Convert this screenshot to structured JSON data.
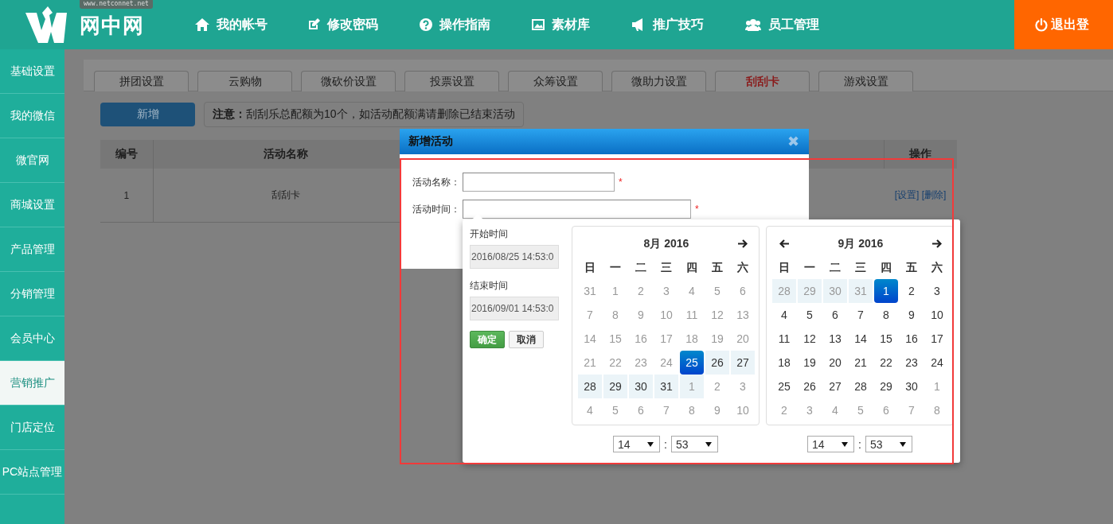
{
  "header": {
    "logo": {
      "domain": "www.netconnet.net",
      "name": "网中网"
    },
    "nav": [
      {
        "label": "我的帐号"
      },
      {
        "label": "修改密码"
      },
      {
        "label": "操作指南"
      },
      {
        "label": "素材库"
      },
      {
        "label": "推广技巧"
      },
      {
        "label": "员工管理"
      }
    ],
    "logout": "退出登"
  },
  "sidebar": {
    "items": [
      {
        "label": "基础设置",
        "selected": false
      },
      {
        "label": "我的微信",
        "selected": false
      },
      {
        "label": "微官网",
        "selected": false
      },
      {
        "label": "商城设置",
        "selected": false
      },
      {
        "label": "产品管理",
        "selected": false
      },
      {
        "label": "分销管理",
        "selected": false
      },
      {
        "label": "会员中心",
        "selected": false
      },
      {
        "label": "营销推广",
        "selected": true
      },
      {
        "label": "门店定位",
        "selected": false
      },
      {
        "label": "PC站点管理",
        "selected": false
      }
    ]
  },
  "tabs": [
    {
      "label": "拼团设置",
      "selected": false
    },
    {
      "label": "云购物",
      "selected": false
    },
    {
      "label": "微砍价设置",
      "selected": false
    },
    {
      "label": "投票设置",
      "selected": false
    },
    {
      "label": "众筹设置",
      "selected": false
    },
    {
      "label": "微助力设置",
      "selected": false
    },
    {
      "label": "刮刮卡",
      "selected": true
    },
    {
      "label": "游戏设置",
      "selected": false
    }
  ],
  "toolbar": {
    "add_button": "新增",
    "notice": "**注意：**刮刮乐总配额为10个，如活动配额满请删除已结束活动"
  },
  "table": {
    "columns": [
      "编号",
      "活动名称",
      "操作"
    ],
    "rows": [
      {
        "cells": [
          "1",
          "刮刮卡"
        ],
        "actions": [
          "[设置]",
          "[删除]"
        ]
      }
    ]
  },
  "dialog": {
    "title": "新增活动",
    "close": "✖",
    "fields": [
      {
        "label": "活动名称：",
        "mark": "*"
      },
      {
        "label": "活动时间：",
        "mark": "*"
      }
    ]
  },
  "picker": {
    "start_label": "开始时间",
    "start_value": "2016/08/25 14:53:0",
    "end_label": "结束时间",
    "end_value": "2016/09/01 14:53:0",
    "ok": "确定",
    "cancel": "取消",
    "months": [
      {
        "title": "8月 2016",
        "prev": false,
        "next": true,
        "weekdays": [
          "日",
          "一",
          "二",
          "三",
          "四",
          "五",
          "六"
        ],
        "hour": "14",
        "minute": "53",
        "separator": ":",
        "weeks": [
          [
            {
              "day": "31",
              "muted": true,
              "in_range": false,
              "selected": false
            },
            {
              "day": "1",
              "muted": true,
              "in_range": false,
              "selected": false
            },
            {
              "day": "2",
              "muted": true,
              "in_range": false,
              "selected": false
            },
            {
              "day": "3",
              "muted": true,
              "in_range": false,
              "selected": false
            },
            {
              "day": "4",
              "muted": true,
              "in_range": false,
              "selected": false
            },
            {
              "day": "5",
              "muted": true,
              "in_range": false,
              "selected": false
            },
            {
              "day": "6",
              "muted": true,
              "in_range": false,
              "selected": false
            }
          ],
          [
            {
              "day": "7",
              "muted": true,
              "in_range": false,
              "selected": false
            },
            {
              "day": "8",
              "muted": true,
              "in_range": false,
              "selected": false
            },
            {
              "day": "9",
              "muted": true,
              "in_range": false,
              "selected": false
            },
            {
              "day": "10",
              "muted": true,
              "in_range": false,
              "selected": false
            },
            {
              "day": "11",
              "muted": true,
              "in_range": false,
              "selected": false
            },
            {
              "day": "12",
              "muted": true,
              "in_range": false,
              "selected": false
            },
            {
              "day": "13",
              "muted": true,
              "in_range": false,
              "selected": false
            }
          ],
          [
            {
              "day": "14",
              "muted": true,
              "in_range": false,
              "selected": false
            },
            {
              "day": "15",
              "muted": true,
              "in_range": false,
              "selected": false
            },
            {
              "day": "16",
              "muted": true,
              "in_range": false,
              "selected": false
            },
            {
              "day": "17",
              "muted": true,
              "in_range": false,
              "selected": false
            },
            {
              "day": "18",
              "muted": true,
              "in_range": false,
              "selected": false
            },
            {
              "day": "19",
              "muted": true,
              "in_range": false,
              "selected": false
            },
            {
              "day": "20",
              "muted": true,
              "in_range": false,
              "selected": false
            }
          ],
          [
            {
              "day": "21",
              "muted": true,
              "in_range": false,
              "selected": false
            },
            {
              "day": "22",
              "muted": true,
              "in_range": false,
              "selected": false
            },
            {
              "day": "23",
              "muted": true,
              "in_range": false,
              "selected": false
            },
            {
              "day": "24",
              "muted": true,
              "in_range": false,
              "selected": false
            },
            {
              "day": "25",
              "muted": false,
              "in_range": false,
              "selected": true
            },
            {
              "day": "26",
              "muted": false,
              "in_range": true,
              "selected": false
            },
            {
              "day": "27",
              "muted": false,
              "in_range": true,
              "selected": false
            }
          ],
          [
            {
              "day": "28",
              "muted": false,
              "in_range": true,
              "selected": false
            },
            {
              "day": "29",
              "muted": false,
              "in_range": true,
              "selected": false
            },
            {
              "day": "30",
              "muted": false,
              "in_range": true,
              "selected": false
            },
            {
              "day": "31",
              "muted": false,
              "in_range": true,
              "selected": false
            },
            {
              "day": "1",
              "muted": true,
              "in_range": true,
              "selected": false
            },
            {
              "day": "2",
              "muted": true,
              "in_range": false,
              "selected": false
            },
            {
              "day": "3",
              "muted": true,
              "in_range": false,
              "selected": false
            }
          ],
          [
            {
              "day": "4",
              "muted": true,
              "in_range": false,
              "selected": false
            },
            {
              "day": "5",
              "muted": true,
              "in_range": false,
              "selected": false
            },
            {
              "day": "6",
              "muted": true,
              "in_range": false,
              "selected": false
            },
            {
              "day": "7",
              "muted": true,
              "in_range": false,
              "selected": false
            },
            {
              "day": "8",
              "muted": true,
              "in_range": false,
              "selected": false
            },
            {
              "day": "9",
              "muted": true,
              "in_range": false,
              "selected": false
            },
            {
              "day": "10",
              "muted": true,
              "in_range": false,
              "selected": false
            }
          ]
        ]
      },
      {
        "title": "9月 2016",
        "prev": true,
        "next": true,
        "weekdays": [
          "日",
          "一",
          "二",
          "三",
          "四",
          "五",
          "六"
        ],
        "hour": "14",
        "minute": "53",
        "separator": ":",
        "weeks": [
          [
            {
              "day": "28",
              "muted": true,
              "in_range": true,
              "selected": false
            },
            {
              "day": "29",
              "muted": true,
              "in_range": true,
              "selected": false
            },
            {
              "day": "30",
              "muted": true,
              "in_range": true,
              "selected": false
            },
            {
              "day": "31",
              "muted": true,
              "in_range": true,
              "selected": false
            },
            {
              "day": "1",
              "muted": false,
              "in_range": false,
              "selected": true
            },
            {
              "day": "2",
              "muted": false,
              "in_range": false,
              "selected": false
            },
            {
              "day": "3",
              "muted": false,
              "in_range": false,
              "selected": false
            }
          ],
          [
            {
              "day": "4",
              "muted": false,
              "in_range": false,
              "selected": false
            },
            {
              "day": "5",
              "muted": false,
              "in_range": false,
              "selected": false
            },
            {
              "day": "6",
              "muted": false,
              "in_range": false,
              "selected": false
            },
            {
              "day": "7",
              "muted": false,
              "in_range": false,
              "selected": false
            },
            {
              "day": "8",
              "muted": false,
              "in_range": false,
              "selected": false
            },
            {
              "day": "9",
              "muted": false,
              "in_range": false,
              "selected": false
            },
            {
              "day": "10",
              "muted": false,
              "in_range": false,
              "selected": false
            }
          ],
          [
            {
              "day": "11",
              "muted": false,
              "in_range": false,
              "selected": false
            },
            {
              "day": "12",
              "muted": false,
              "in_range": false,
              "selected": false
            },
            {
              "day": "13",
              "muted": false,
              "in_range": false,
              "selected": false
            },
            {
              "day": "14",
              "muted": false,
              "in_range": false,
              "selected": false
            },
            {
              "day": "15",
              "muted": false,
              "in_range": false,
              "selected": false
            },
            {
              "day": "16",
              "muted": false,
              "in_range": false,
              "selected": false
            },
            {
              "day": "17",
              "muted": false,
              "in_range": false,
              "selected": false
            }
          ],
          [
            {
              "day": "18",
              "muted": false,
              "in_range": false,
              "selected": false
            },
            {
              "day": "19",
              "muted": false,
              "in_range": false,
              "selected": false
            },
            {
              "day": "20",
              "muted": false,
              "in_range": false,
              "selected": false
            },
            {
              "day": "21",
              "muted": false,
              "in_range": false,
              "selected": false
            },
            {
              "day": "22",
              "muted": false,
              "in_range": false,
              "selected": false
            },
            {
              "day": "23",
              "muted": false,
              "in_range": false,
              "selected": false
            },
            {
              "day": "24",
              "muted": false,
              "in_range": false,
              "selected": false
            }
          ],
          [
            {
              "day": "25",
              "muted": false,
              "in_range": false,
              "selected": false
            },
            {
              "day": "26",
              "muted": false,
              "in_range": false,
              "selected": false
            },
            {
              "day": "27",
              "muted": false,
              "in_range": false,
              "selected": false
            },
            {
              "day": "28",
              "muted": false,
              "in_range": false,
              "selected": false
            },
            {
              "day": "29",
              "muted": false,
              "in_range": false,
              "selected": false
            },
            {
              "day": "30",
              "muted": false,
              "in_range": false,
              "selected": false
            },
            {
              "day": "1",
              "muted": true,
              "in_range": false,
              "selected": false
            }
          ],
          [
            {
              "day": "2",
              "muted": true,
              "in_range": false,
              "selected": false
            },
            {
              "day": "3",
              "muted": true,
              "in_range": false,
              "selected": false
            },
            {
              "day": "4",
              "muted": true,
              "in_range": false,
              "selected": false
            },
            {
              "day": "5",
              "muted": true,
              "in_range": false,
              "selected": false
            },
            {
              "day": "6",
              "muted": true,
              "in_range": false,
              "selected": false
            },
            {
              "day": "7",
              "muted": true,
              "in_range": false,
              "selected": false
            },
            {
              "day": "8",
              "muted": true,
              "in_range": false,
              "selected": false
            }
          ]
        ]
      }
    ]
  }
}
